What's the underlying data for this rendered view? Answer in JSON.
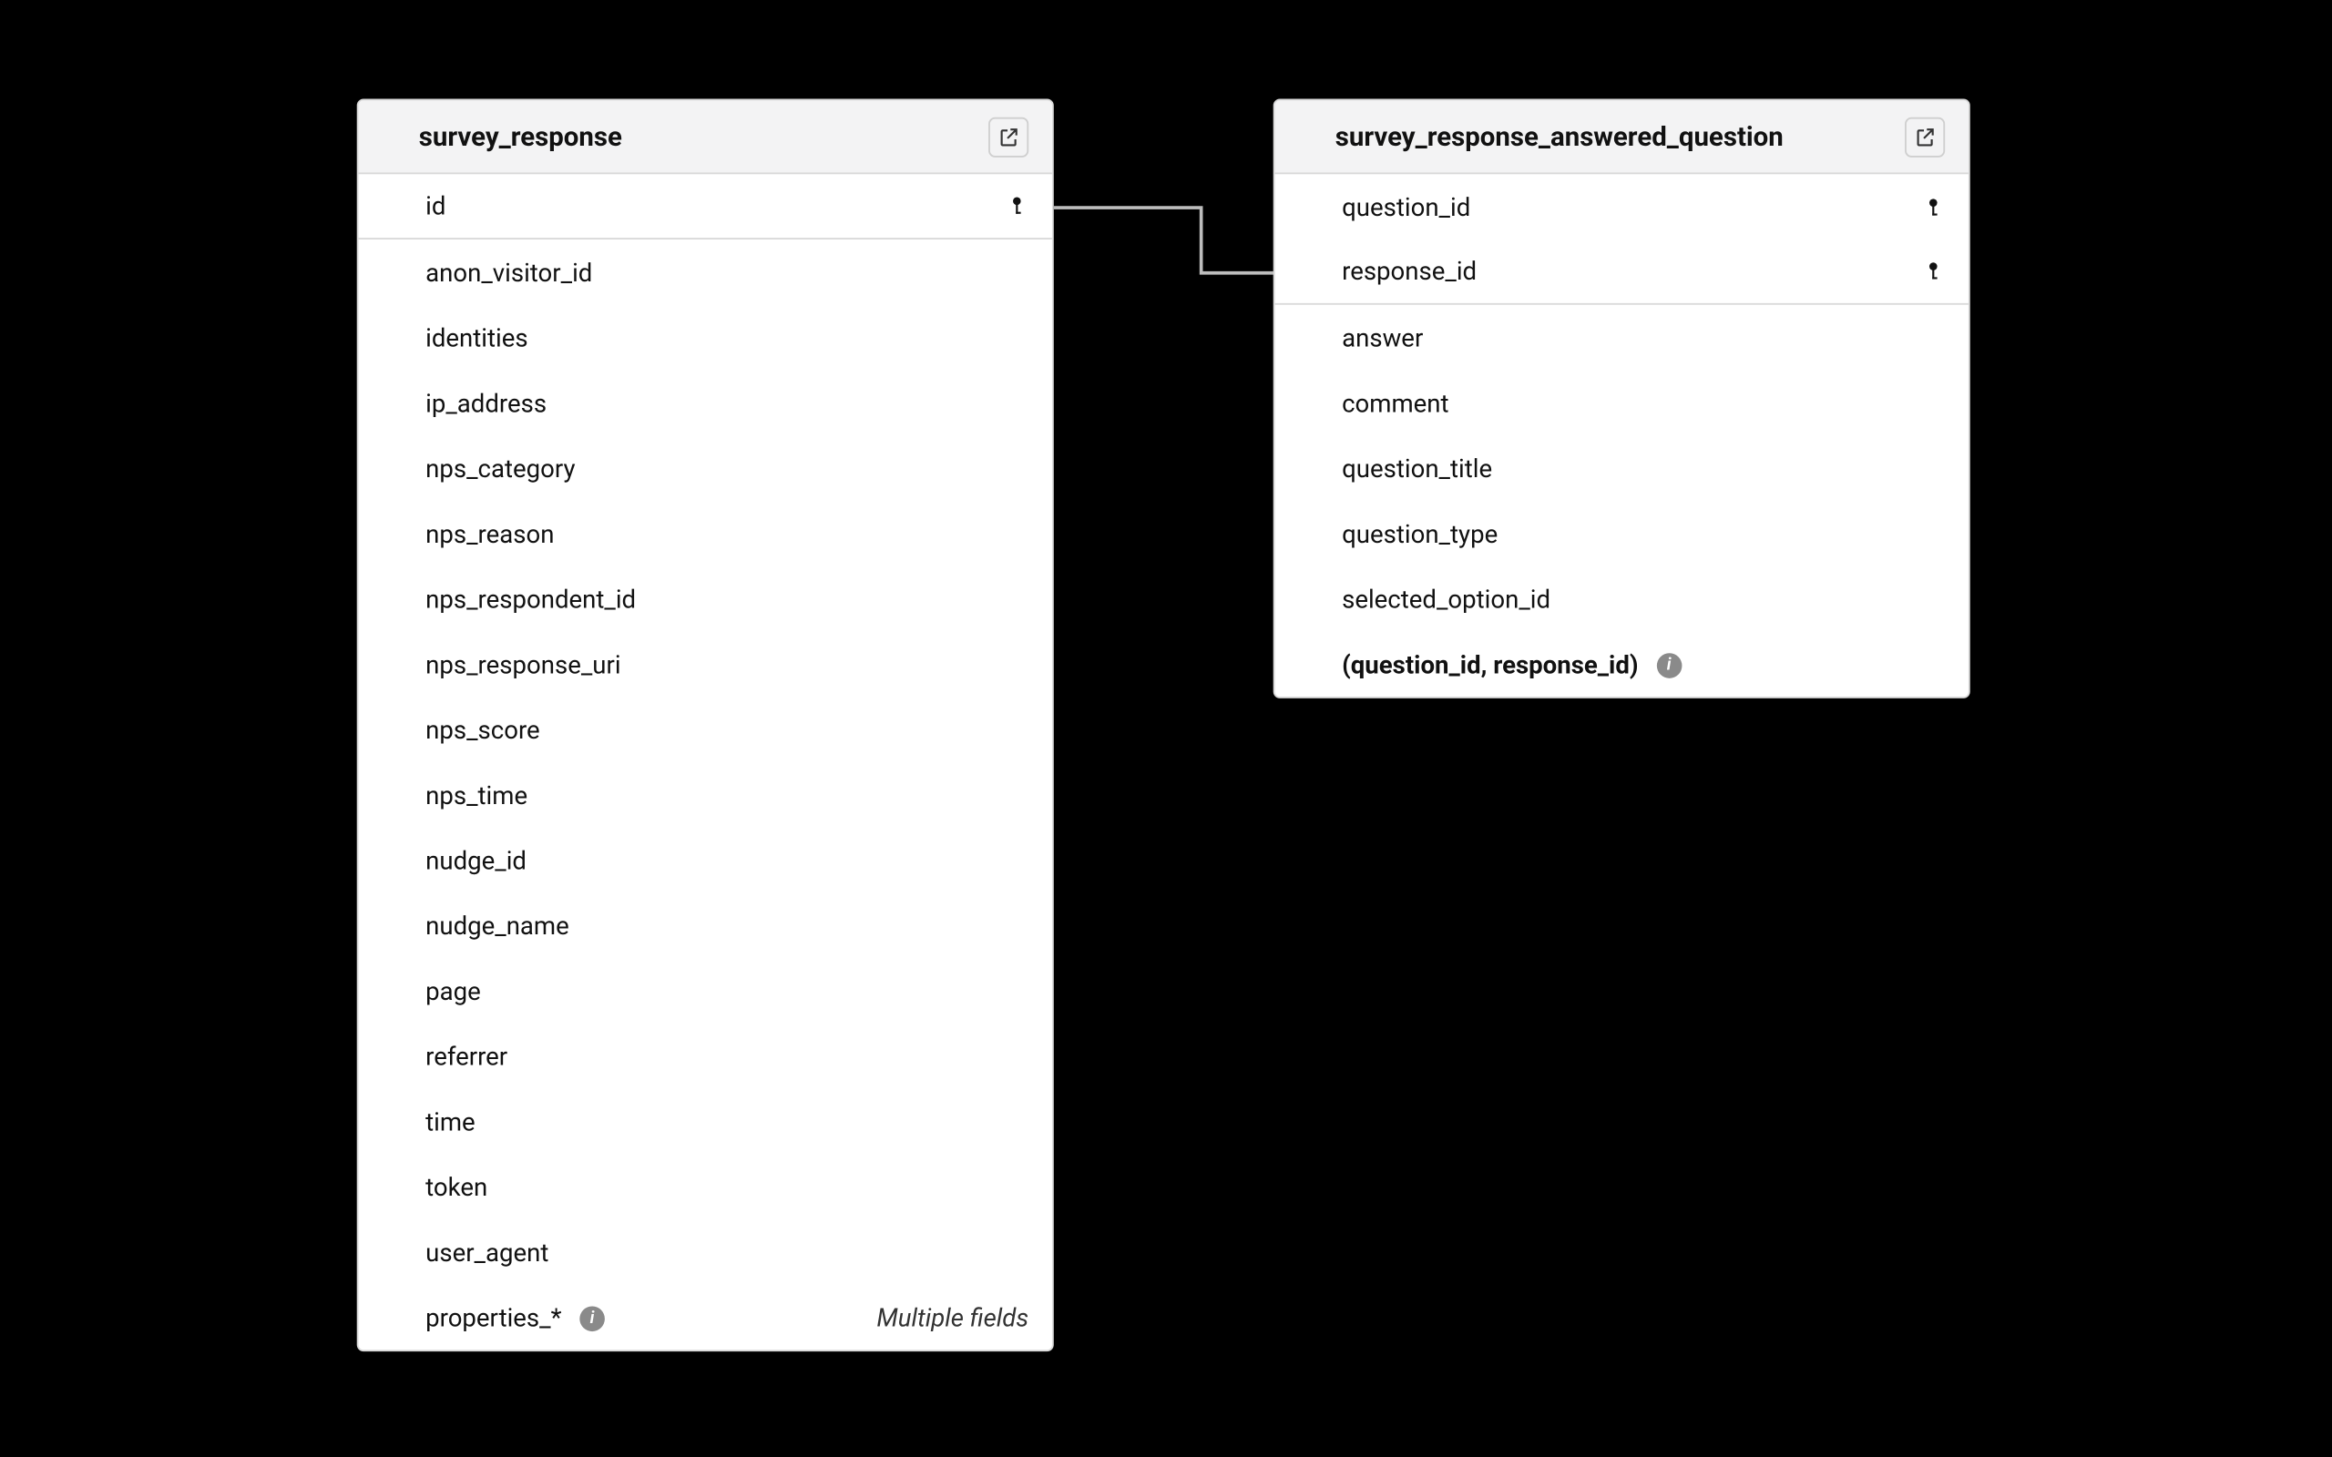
{
  "entities": {
    "survey_response": {
      "title": "survey_response",
      "primary_keys": [
        {
          "name": "id"
        }
      ],
      "fields": [
        {
          "name": "anon_visitor_id"
        },
        {
          "name": "identities"
        },
        {
          "name": "ip_address"
        },
        {
          "name": "nps_category"
        },
        {
          "name": "nps_reason"
        },
        {
          "name": "nps_respondent_id"
        },
        {
          "name": "nps_response_uri"
        },
        {
          "name": "nps_score"
        },
        {
          "name": "nps_time"
        },
        {
          "name": "nudge_id"
        },
        {
          "name": "nudge_name"
        },
        {
          "name": "page"
        },
        {
          "name": "referrer"
        },
        {
          "name": "time"
        },
        {
          "name": "token"
        },
        {
          "name": "user_agent"
        }
      ],
      "footer": {
        "name": "properties_*",
        "note": "Multiple fields"
      }
    },
    "survey_response_answered_question": {
      "title": "survey_response_answered_question",
      "primary_keys": [
        {
          "name": "question_id"
        },
        {
          "name": "response_id"
        }
      ],
      "fields": [
        {
          "name": "answer"
        },
        {
          "name": "comment"
        },
        {
          "name": "question_title"
        },
        {
          "name": "question_type"
        },
        {
          "name": "selected_option_id"
        }
      ],
      "footer": {
        "name": "(question_id, response_id)"
      }
    }
  },
  "relationship": {
    "from": "survey_response.id",
    "to": "survey_response_answered_question.response_id"
  }
}
